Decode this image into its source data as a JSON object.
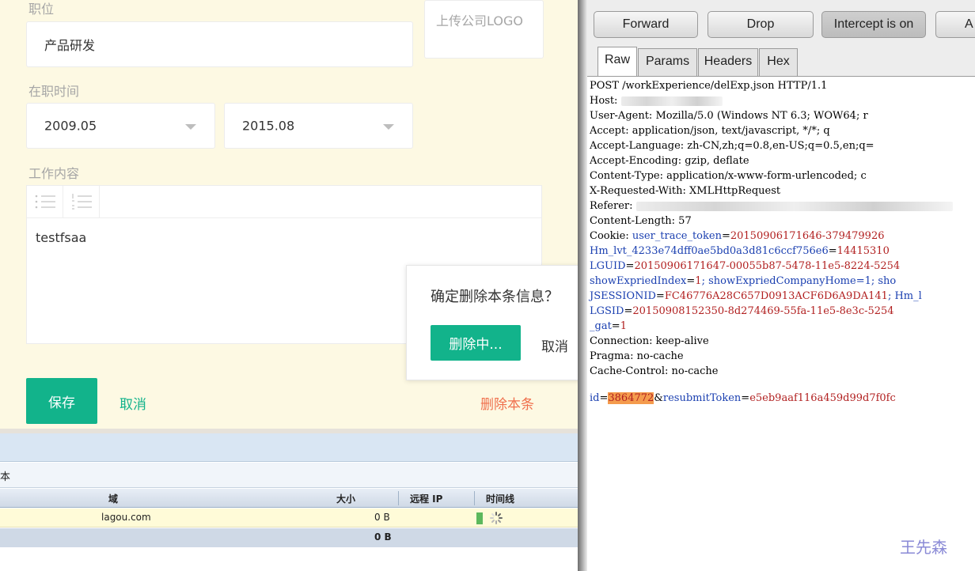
{
  "form": {
    "position_label": "职位",
    "position_value": "产品研发",
    "logo_upload_label": "上传公司LOGO",
    "tenure_label": "在职时间",
    "start_date": "2009.05",
    "end_date": "2015.08",
    "content_label": "工作内容",
    "content_text": "testfsaa",
    "save_label": "保存",
    "cancel_label": "取消",
    "delete_label": "删除本条"
  },
  "confirm_popup": {
    "message": "确定删除本条信息？",
    "deleting_label": "删除中...",
    "cancel_label": "取消"
  },
  "network_panel": {
    "subheader_text": "本",
    "columns": [
      "域",
      "大小",
      "远程 IP",
      "时间线"
    ],
    "rows": [
      {
        "domain": "lagou.com",
        "size": "0 B"
      }
    ],
    "total_size": "0 B"
  },
  "burp": {
    "buttons": [
      "Forward",
      "Drop",
      "Intercept is on",
      "A"
    ],
    "tabs": [
      "Raw",
      "Params",
      "Headers",
      "Hex"
    ],
    "request": {
      "line1": "POST /workExperience/delExp.json HTTP/1.1",
      "host_label": "Host: ",
      "user_agent": "User-Agent: Mozilla/5.0 (Windows NT 6.3; WOW64; r",
      "accept": "Accept: application/json, text/javascript, */*; q",
      "accept_language": "Accept-Language: zh-CN,zh;q=0.8,en-US;q=0.5,en;q=",
      "accept_encoding": "Accept-Encoding: gzip, deflate",
      "content_type": "Content-Type: application/x-www-form-urlencoded; c",
      "x_requested_with": "X-Requested-With: XMLHttpRequest",
      "referer_label": "Referer: ",
      "content_length": "Content-Length: 57",
      "cookie_label": "Cookie: ",
      "cookie_lines": [
        {
          "k": "user_trace_token",
          "v": "20150906171646-379479926",
          "pre": "",
          "suffix": ""
        },
        {
          "k": "Hm_lvt_4233e74dff0ae5bd0a3d81c6ccf756e6",
          "v": "14415310",
          "pre": "",
          "suffix": ""
        },
        {
          "k": "LGUID",
          "v": "20150906171647-00055b87-5478-11e5-8224-5254",
          "pre": "",
          "suffix": ""
        },
        {
          "k": "showExpriedIndex",
          "v": "1",
          "pre": "",
          "suffix": "; showExpriedCompanyHome=1; sho"
        },
        {
          "k": "JSESSIONID",
          "v": "FC46776A28C657D0913ACF6D6A9DA141",
          "pre": "",
          "suffix": "; Hm_l"
        },
        {
          "k": "LGSID",
          "v": "20150908152350-8d274469-55fa-11e5-8e3c-5254",
          "pre": "",
          "suffix": ""
        },
        {
          "k": "_gat",
          "v": "1",
          "pre": "",
          "suffix": ""
        }
      ],
      "connection": "Connection: keep-alive",
      "pragma": "Pragma: no-cache",
      "cache_control": "Cache-Control: no-cache",
      "body_key1": "id",
      "body_val1": "3864772",
      "body_key2": "resubmitToken",
      "body_val2": "e5eb9aaf116a459d99d7f0fc"
    }
  },
  "watermark": "王先森",
  "colors": {
    "accent_green": "#12b38b",
    "delete_red": "#f0704d",
    "cookie_key_blue": "#1a3fb0",
    "cookie_val_red": "#b11f1f",
    "highlight_orange": "#f49b4d"
  }
}
